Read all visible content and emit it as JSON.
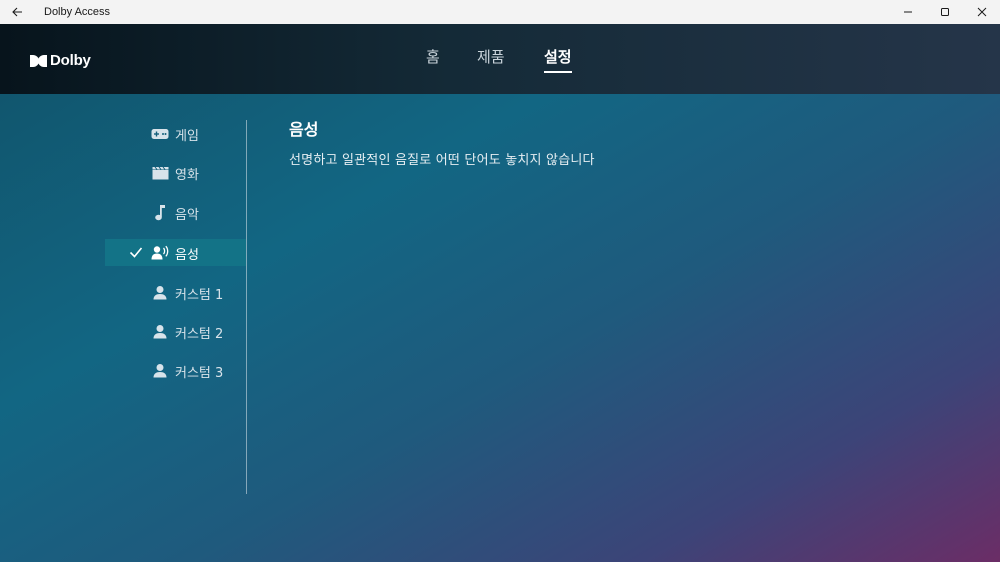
{
  "window": {
    "title": "Dolby Access"
  },
  "header": {
    "logo_text": "Dolby",
    "nav": [
      {
        "label": "홈",
        "active": false
      },
      {
        "label": "제품",
        "active": false
      },
      {
        "label": "설정",
        "active": true
      }
    ]
  },
  "sidebar": {
    "items": [
      {
        "label": "게임",
        "icon": "gamepad-icon",
        "selected": false
      },
      {
        "label": "영화",
        "icon": "clapperboard-icon",
        "selected": false
      },
      {
        "label": "음악",
        "icon": "music-note-icon",
        "selected": false
      },
      {
        "label": "음성",
        "icon": "voice-icon",
        "selected": true
      },
      {
        "label": "커스텀 1",
        "icon": "person-icon",
        "selected": false
      },
      {
        "label": "커스텀 2",
        "icon": "person-icon",
        "selected": false
      },
      {
        "label": "커스텀 3",
        "icon": "person-icon",
        "selected": false
      }
    ]
  },
  "main": {
    "title": "음성",
    "description": "선명하고 일관적인 음질로 어떤 단어도 놓치지 않습니다"
  },
  "colors": {
    "accent_selected": "#137387",
    "text_primary": "#ffffff"
  }
}
